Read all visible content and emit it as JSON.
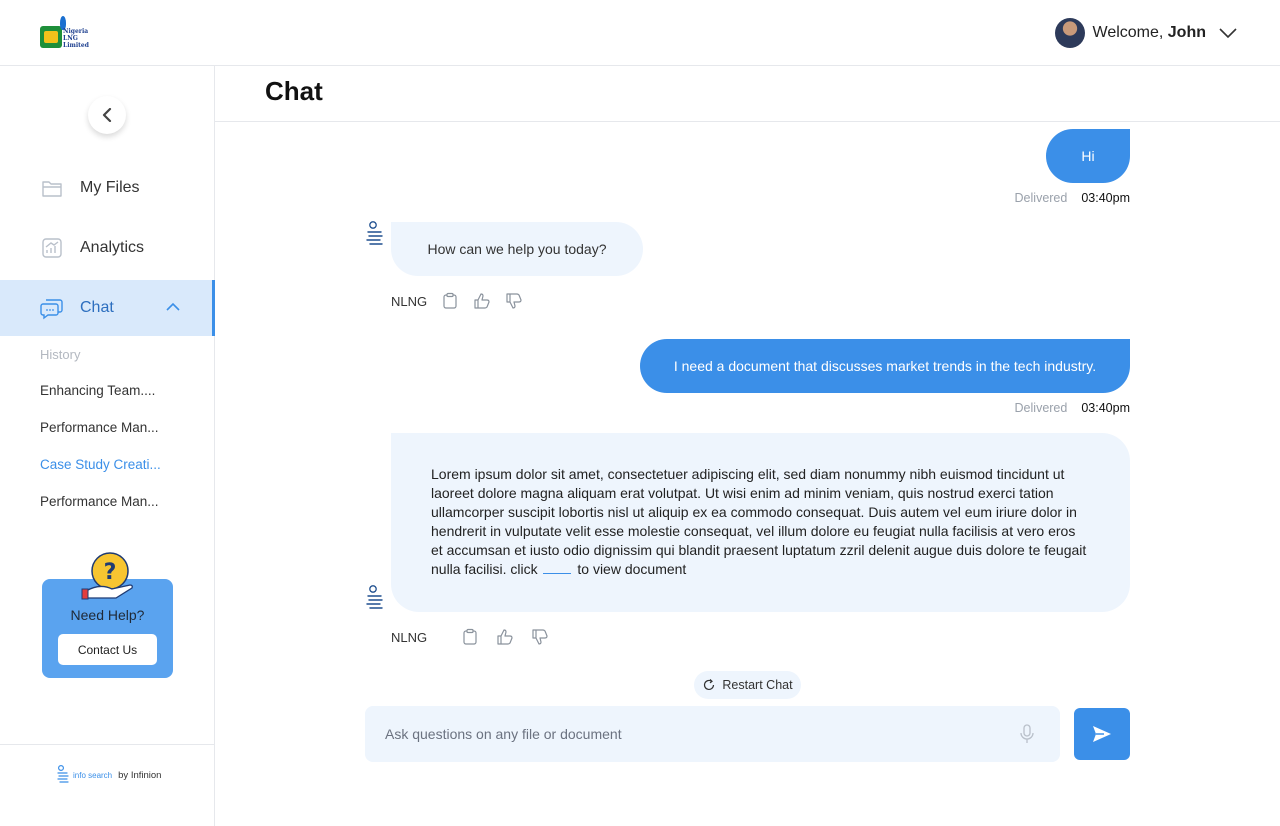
{
  "header": {
    "logo_text": "Nigeria LNG Limited",
    "welcome_prefix": "Welcome, ",
    "user_name": "John"
  },
  "sidebar": {
    "items": [
      {
        "label": "My Files",
        "icon": "folder-icon"
      },
      {
        "label": "Analytics",
        "icon": "analytics-icon"
      },
      {
        "label": "Chat",
        "icon": "chat-icon",
        "active": true
      }
    ],
    "history_title": "History",
    "history": [
      {
        "label": "Enhancing Team...."
      },
      {
        "label": "Performance Man..."
      },
      {
        "label": "Case Study Creati...",
        "active": true
      },
      {
        "label": "Performance Man..."
      }
    ],
    "help": {
      "title": "Need Help?",
      "button": "Contact Us"
    },
    "footer": {
      "brand": "info search",
      "by": "by Infinion"
    }
  },
  "main": {
    "title": "Chat",
    "messages": [
      {
        "from": "user",
        "text": "Hi",
        "status": "Delivered",
        "time": "03:40pm"
      },
      {
        "from": "bot",
        "text": "How can we help you today?",
        "source": "NLNG"
      },
      {
        "from": "user",
        "text": "I need a document that discusses market trends in the tech industry.",
        "status": "Delivered",
        "time": "03:40pm"
      },
      {
        "from": "bot",
        "text": "Lorem ipsum dolor sit amet, consectetuer adipiscing elit, sed diam nonummy nibh euismod tincidunt ut laoreet dolore magna aliquam erat volutpat. Ut wisi enim ad minim veniam, quis nostrud exerci tation ullamcorper suscipit lobortis nisl ut aliquip ex ea commodo consequat. Duis autem vel eum iriure dolor in hendrerit in vulputate velit esse molestie consequat, vel illum dolore eu feugiat nulla facilisis at vero eros et accumsan et iusto odio dignissim qui blandit praesent luptatum zzril delenit augue duis dolore te feugait nulla facilisi. click",
        "link_suffix": "to view document",
        "source": "NLNG"
      }
    ],
    "restart_label": "Restart Chat",
    "input_placeholder": "Ask questions on any file or document"
  },
  "colors": {
    "accent": "#3b8fe8",
    "bubble_in": "#eef5fd",
    "active_nav": "#d9e9fb"
  }
}
